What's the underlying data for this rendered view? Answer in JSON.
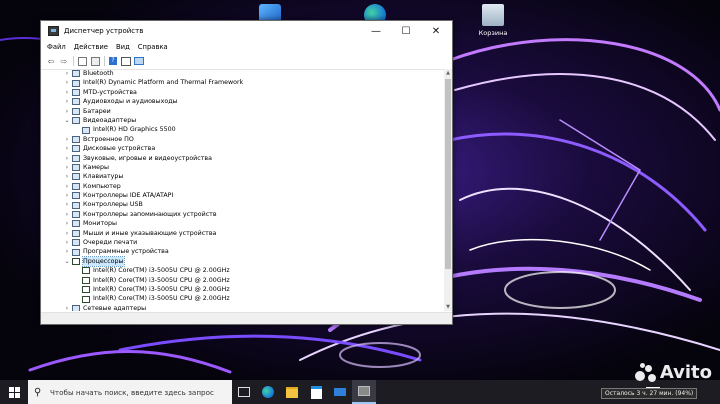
{
  "desktop": {
    "icons": [
      {
        "name": "recycle-bin",
        "label": "Корзина"
      }
    ]
  },
  "window": {
    "title": "Диспетчер устройств",
    "controls": {
      "minimize": "—",
      "maximize": "☐",
      "close": "✕"
    },
    "menu": [
      "Файл",
      "Действие",
      "Вид",
      "Справка"
    ],
    "toolbar_icons": [
      "back-icon",
      "forward-icon",
      "device-view-icon",
      "properties-icon",
      "help-icon",
      "scan-icon",
      "monitor-icon"
    ],
    "tree": [
      {
        "label": "Bluetooth",
        "expand": "›",
        "icon": "bluetooth-icon"
      },
      {
        "label": "Intel(R) Dynamic Platform and Thermal Framework",
        "expand": "›",
        "icon": "chip-icon"
      },
      {
        "label": "MTD-устройства",
        "expand": "›",
        "icon": "storage-icon"
      },
      {
        "label": "Аудиовходы и аудиовыходы",
        "expand": "›",
        "icon": "speaker-icon"
      },
      {
        "label": "Батареи",
        "expand": "›",
        "icon": "battery-icon"
      },
      {
        "label": "Видеоадаптеры",
        "expand": "⌄",
        "icon": "display-adapter-icon"
      },
      {
        "label": "Intel(R) HD Graphics 5500",
        "child": true,
        "icon": "display-adapter-icon"
      },
      {
        "label": "Встроенное ПО",
        "expand": "›",
        "icon": "firmware-icon"
      },
      {
        "label": "Дисковые устройства",
        "expand": "›",
        "icon": "disk-icon"
      },
      {
        "label": "Звуковые, игровые и видеоустройства",
        "expand": "›",
        "icon": "sound-icon"
      },
      {
        "label": "Камеры",
        "expand": "›",
        "icon": "camera-icon"
      },
      {
        "label": "Клавиатуры",
        "expand": "›",
        "icon": "keyboard-icon"
      },
      {
        "label": "Компьютер",
        "expand": "›",
        "icon": "computer-icon"
      },
      {
        "label": "Контроллеры IDE ATA/ATAPI",
        "expand": "›",
        "icon": "ide-controller-icon"
      },
      {
        "label": "Контроллеры USB",
        "expand": "›",
        "icon": "usb-icon"
      },
      {
        "label": "Контроллеры запоминающих устройств",
        "expand": "›",
        "icon": "storage-controller-icon"
      },
      {
        "label": "Мониторы",
        "expand": "›",
        "icon": "monitor-icon"
      },
      {
        "label": "Мыши и иные указывающие устройства",
        "expand": "›",
        "icon": "mouse-icon"
      },
      {
        "label": "Очереди печати",
        "expand": "›",
        "icon": "printer-icon"
      },
      {
        "label": "Программные устройства",
        "expand": "›",
        "icon": "software-device-icon"
      },
      {
        "label": "Процессоры",
        "expand": "⌄",
        "icon": "cpu-icon",
        "selected": true
      },
      {
        "label": "Intel(R) Core(TM) i3-5005U CPU @ 2.00GHz",
        "child": true,
        "icon": "cpu-icon"
      },
      {
        "label": "Intel(R) Core(TM) i3-5005U CPU @ 2.00GHz",
        "child": true,
        "icon": "cpu-icon"
      },
      {
        "label": "Intel(R) Core(TM) i3-5005U CPU @ 2.00GHz",
        "child": true,
        "icon": "cpu-icon"
      },
      {
        "label": "Intel(R) Core(TM) i3-5005U CPU @ 2.00GHz",
        "child": true,
        "icon": "cpu-icon"
      },
      {
        "label": "Сетевые адаптеры",
        "expand": "›",
        "icon": "network-icon"
      }
    ]
  },
  "taskbar": {
    "search_placeholder": "Чтобы начать поиск, введите здесь запрос",
    "apps": [
      "edge-icon",
      "file-explorer-icon",
      "store-icon",
      "mail-icon",
      "device-manager-icon"
    ],
    "battery_tooltip": "Осталось 3 ч. 27 мин. (94%)"
  },
  "watermark": {
    "text": "Avito"
  },
  "colors": {
    "selection": "#cce8ff",
    "taskbar": "#1c1c22",
    "search_box": "#f3f3f3"
  }
}
